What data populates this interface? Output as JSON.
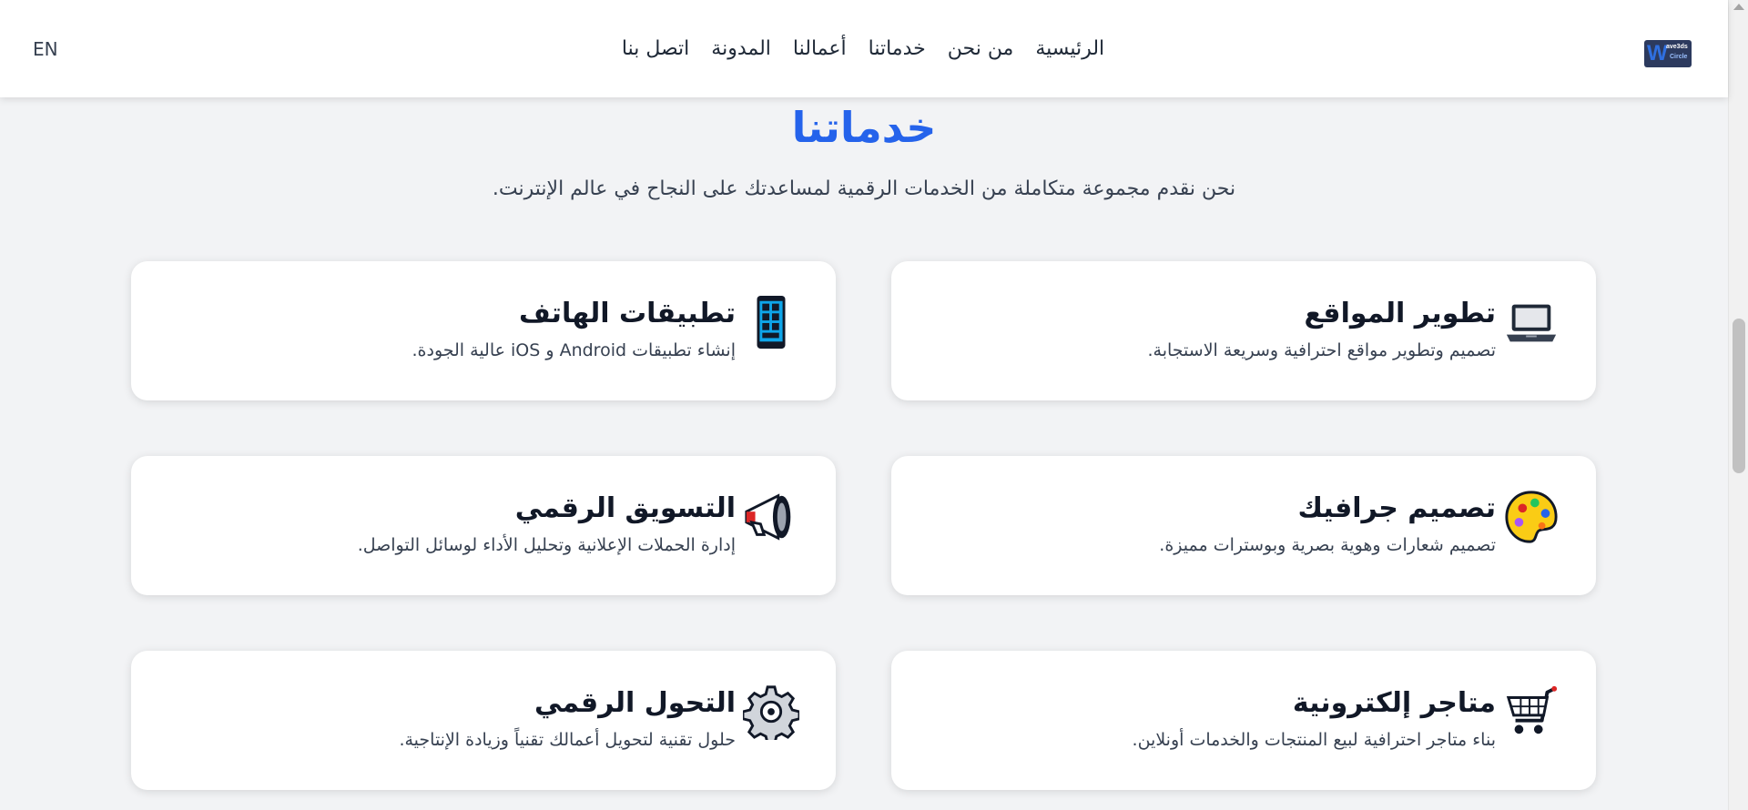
{
  "nav": {
    "logo_text_w": "W",
    "logo_text_top": "ave3ds",
    "logo_text_bottom": "Circle",
    "links": [
      "الرئيسية",
      "من نحن",
      "خدماتنا",
      "أعمالنا",
      "المدونة",
      "اتصل بنا"
    ],
    "lang": "EN"
  },
  "section": {
    "title": "خدماتنا",
    "subtitle": "نحن نقدم مجموعة متكاملة من الخدمات الرقمية لمساعدتك على النجاح في عالم الإنترنت."
  },
  "services": [
    {
      "title": "تطوير المواقع",
      "desc": "تصميم وتطوير مواقع احترافية وسريعة الاستجابة.",
      "icon": "laptop-icon"
    },
    {
      "title": "تطبيقات الهاتف",
      "desc": "إنشاء تطبيقات Android و iOS عالية الجودة.",
      "icon": "mobile-phone-icon"
    },
    {
      "title": "تصميم جرافيك",
      "desc": "تصميم شعارات وهوية بصرية وبوسترات مميزة.",
      "icon": "artist-palette-icon"
    },
    {
      "title": "التسويق الرقمي",
      "desc": "إدارة الحملات الإعلانية وتحليل الأداء لوسائل التواصل.",
      "icon": "megaphone-icon"
    },
    {
      "title": "متاجر إلكترونية",
      "desc": "بناء متاجر احترافية لبيع المنتجات والخدمات أونلاين.",
      "icon": "shopping-cart-icon"
    },
    {
      "title": "التحول الرقمي",
      "desc": "حلول تقنية لتحويل أعمالك تقنياً وزيادة الإنتاجية.",
      "icon": "gear-icon"
    }
  ],
  "colors": {
    "accent": "#2563eb",
    "background": "#f2f3f5",
    "card": "#ffffff"
  }
}
